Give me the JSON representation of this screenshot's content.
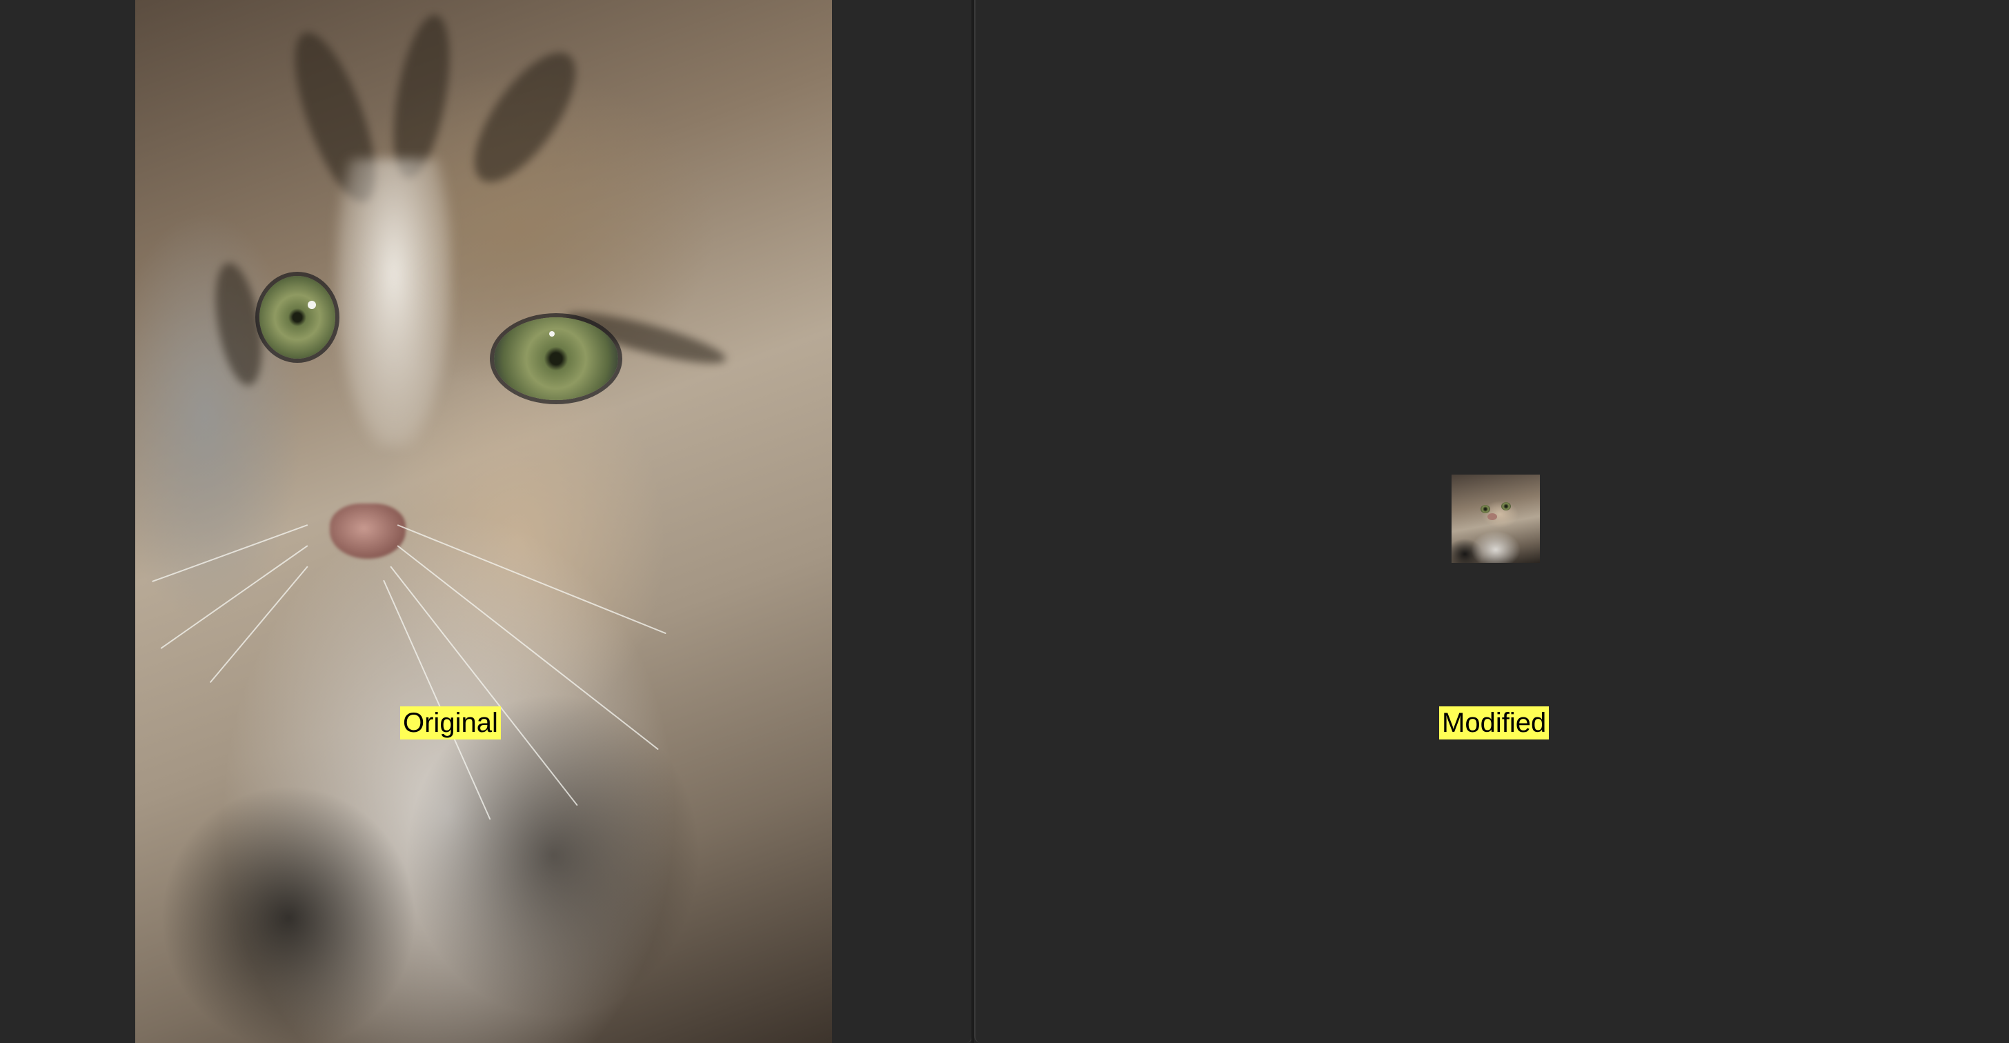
{
  "panels": {
    "original": {
      "label": "Original"
    },
    "modified": {
      "label": "Modified"
    }
  },
  "colors": {
    "background": "#262626",
    "label_background": "#ffff55",
    "label_text": "#000000"
  }
}
